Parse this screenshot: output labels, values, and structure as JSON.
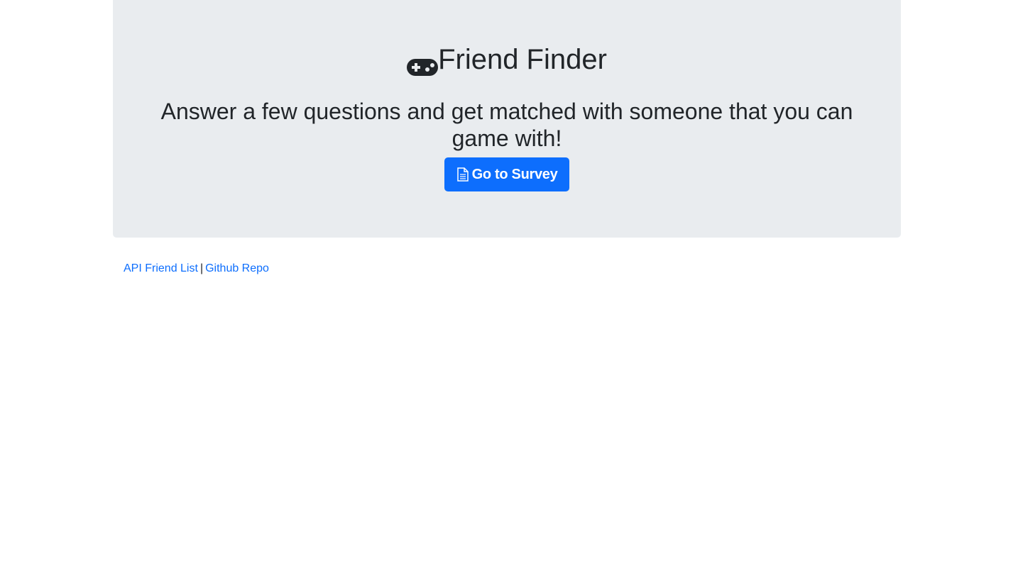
{
  "jumbotron": {
    "title": "Friend Finder",
    "title_icon": "gamepad-icon",
    "lead": "Answer a few questions and get matched with someone that you can game with!",
    "survey_button": {
      "label": "Go to Survey",
      "icon": "file-text-icon"
    }
  },
  "footer": {
    "links": [
      {
        "label": "API Friend List"
      },
      {
        "label": "Github Repo"
      }
    ],
    "separator": "|"
  },
  "colors": {
    "jumbotron_bg": "#e9ecef",
    "primary": "#0d6efd",
    "text": "#212529"
  }
}
